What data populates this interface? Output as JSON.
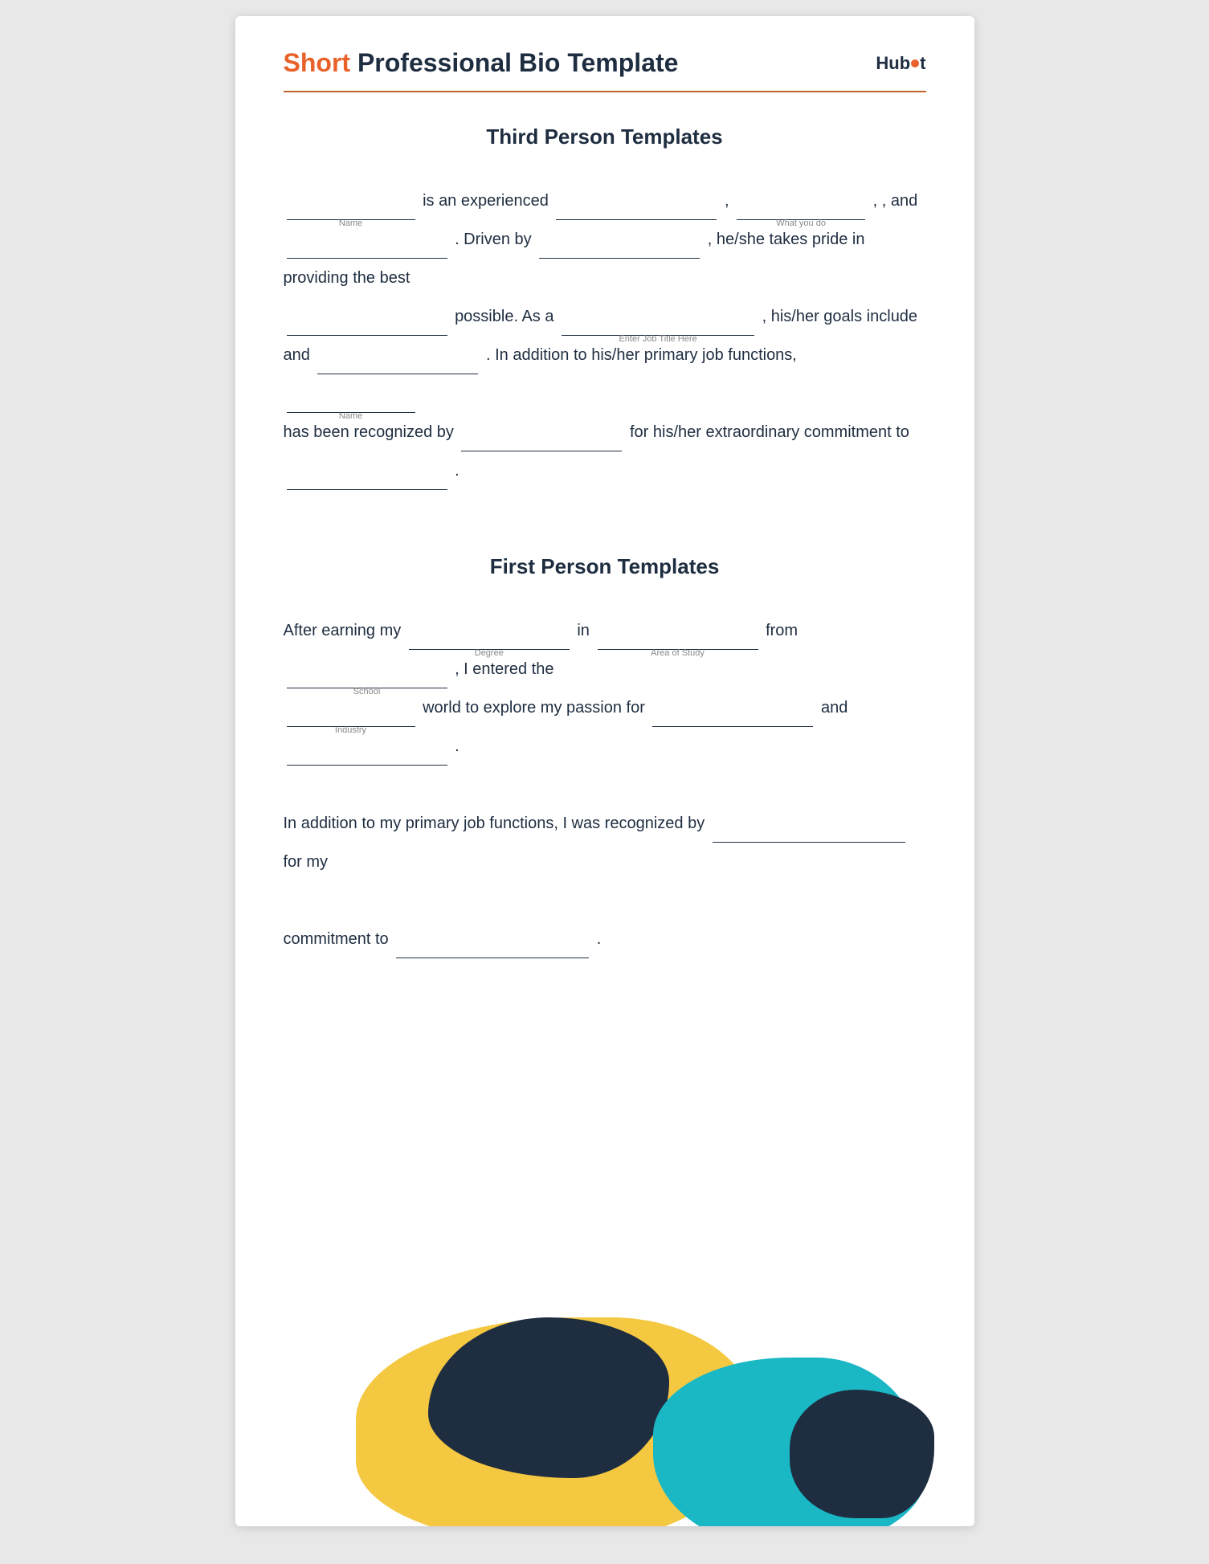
{
  "header": {
    "title_short": "Short",
    "title_rest": " Professional Bio Template",
    "hubspot_label": "HubSpot"
  },
  "third_person": {
    "section_title": "Third Person Templates",
    "blanks": {
      "name1": "Name",
      "what_you_do": "What you do",
      "job_title": "Enter Job Title Here",
      "name2": "Name"
    },
    "text": {
      "line1_a": "is an experienced",
      "line1_b": ", ",
      "line1_c": ", and",
      "line2_a": ". Driven by",
      "line2_b": ", he/she takes pride in providing the best",
      "line3": "possible. As a",
      "line3_b": ", his/her goals include",
      "line4_a": "and",
      "line4_b": ". In addition to his/her primary job functions,",
      "line5_a": "has been recognized by",
      "line5_b": "for his/her extraordinary commitment to",
      "line5_c": "."
    }
  },
  "first_person": {
    "section_title": "First Person Templates",
    "blanks": {
      "degree": "Degree",
      "area_of_study": "Area of Study",
      "school": "School",
      "industry": "Industry"
    },
    "text": {
      "line1_a": "After earning my",
      "line1_b": "in",
      "line1_c": "from",
      "line1_d": ", I entered the",
      "line2_a": "world to explore my passion for",
      "line2_b": "and",
      "line2_c": ".",
      "line3_a": "In addition to my primary job functions, I was recognized by",
      "line3_b": "for my",
      "line4_a": "commitment to",
      "line4_b": "."
    }
  }
}
